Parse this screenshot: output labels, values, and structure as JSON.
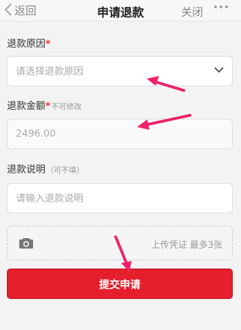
{
  "nav": {
    "back_label": "返回",
    "title": "申请退款",
    "close_label": "关闭"
  },
  "form": {
    "reason": {
      "label": "退款原因",
      "required_mark": "*",
      "placeholder": "请选择退款原因"
    },
    "amount": {
      "label": "退款金额",
      "required_mark": "*",
      "hint": "不可修改",
      "value": "2496.00"
    },
    "note": {
      "label": "退款说明",
      "hint": "（可不填）",
      "placeholder": "请输入退款说明"
    },
    "upload": {
      "label": "上传凭证 最多3张",
      "icon": "camera-icon"
    },
    "submit_label": "提交申请"
  },
  "colors": {
    "accent": "#e61f2c",
    "required": "#e33333",
    "annotation_arrow": "#f0206a",
    "background": "#f3f3f3"
  }
}
